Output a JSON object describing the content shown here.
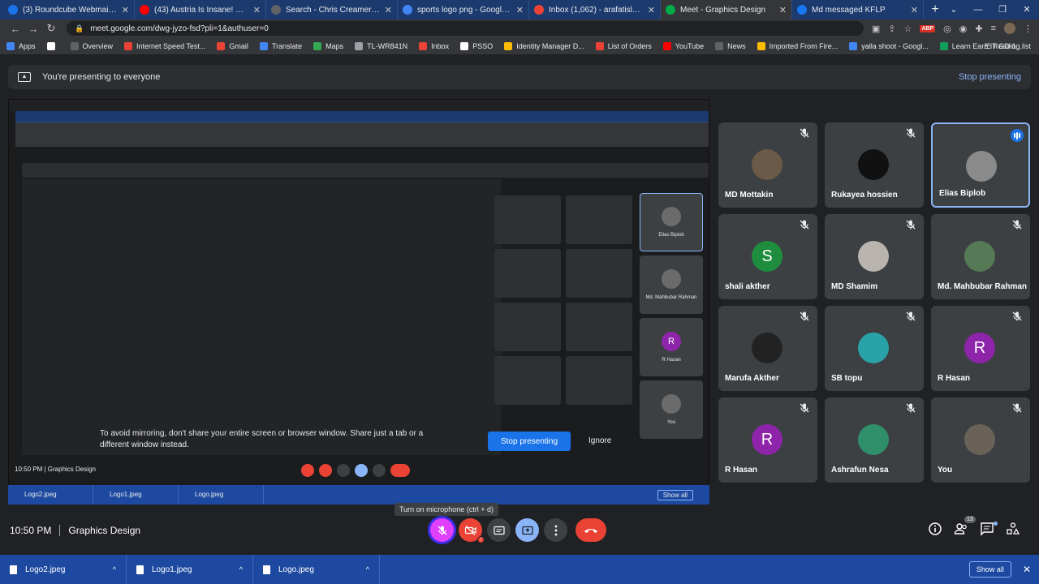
{
  "browser": {
    "tabs": [
      {
        "label": "(3) Roundcube Webmail :: Inbox",
        "color": "#1a73e8"
      },
      {
        "label": "(43) Austria Is Insane! Why You",
        "color": "#ff0000"
      },
      {
        "label": "Search - Chris Creamer's Sports",
        "color": "#5f6368"
      },
      {
        "label": "sports logo png - Google Search",
        "color": "#4285f4"
      },
      {
        "label": "Inbox (1,062) - arafatislamrussel",
        "color": "#ea4335"
      },
      {
        "label": "Meet - Graphics Design",
        "color": "#00ac47"
      },
      {
        "label": "Md messaged KFLP",
        "color": "#1877f2"
      }
    ],
    "url": "meet.google.com/dwg-jyzo-fsd?pli=1&authuser=0",
    "bookmarks": [
      "Apps",
      "",
      "Overview",
      "Internet Speed Test...",
      "Gmail",
      "Translate",
      "Maps",
      "TL-WR841N",
      "Inbox",
      "PSSO",
      "Identity Manager D...",
      "List of Orders",
      "YouTube",
      "News",
      "Imported From Fire...",
      "yalla shoot - Googl...",
      "Learn Earn IT GD-1..."
    ],
    "reading_list": "Reading list"
  },
  "banner": {
    "text": "You're presenting to everyone",
    "stop_label": "Stop presenting"
  },
  "nested": {
    "message": "To avoid mirroring, don't share your entire screen or browser window. Share just a tab or a different window instead.",
    "stop_label": "Stop presenting",
    "ignore_label": "Ignore",
    "time": "10:50 PM",
    "meeting": "Graphics Design",
    "tiles": [
      "Elias Biplob",
      "Md. Mahbubar Rahman",
      "R Hasan",
      "You"
    ],
    "downloads": [
      "Logo2.jpeg",
      "Logo1.jpeg",
      "Logo.jpeg"
    ],
    "show_all": "Show all"
  },
  "participants": [
    {
      "name": "MD Mottakin",
      "initial": "",
      "color": "#6b5a48",
      "speaking": false
    },
    {
      "name": "Rukayea hossien",
      "initial": "",
      "color": "#111111",
      "speaking": false
    },
    {
      "name": "Elias Biplob",
      "initial": "",
      "color": "#8a8a8a",
      "speaking": true
    },
    {
      "name": "shali akther",
      "initial": "S",
      "color": "#1e8e3e",
      "speaking": false
    },
    {
      "name": "MD Shamim",
      "initial": "",
      "color": "#b9b4ae",
      "speaking": false
    },
    {
      "name": "Md. Mahbubar Rahman",
      "initial": "",
      "color": "#557a55",
      "speaking": false
    },
    {
      "name": "Marufa Akther",
      "initial": "",
      "color": "#222222",
      "speaking": false
    },
    {
      "name": "SB topu",
      "initial": "",
      "color": "#2aa3a8",
      "speaking": false
    },
    {
      "name": "R Hasan",
      "initial": "R",
      "color": "#8e24aa",
      "speaking": false
    },
    {
      "name": "R Hasan",
      "initial": "R",
      "color": "#8e24aa",
      "speaking": false
    },
    {
      "name": "Ashrafun Nesa",
      "initial": "",
      "color": "#2f8f6a",
      "speaking": false
    },
    {
      "name": "You",
      "initial": "",
      "color": "#6a6259",
      "speaking": false
    }
  ],
  "footer": {
    "time": "10:50 PM",
    "meeting": "Graphics Design",
    "tooltip": "Turn on microphone (ctrl + d)",
    "people_count": "13"
  },
  "downloads": {
    "items": [
      "Logo2.jpeg",
      "Logo1.jpeg",
      "Logo.jpeg"
    ],
    "show_all": "Show all"
  }
}
